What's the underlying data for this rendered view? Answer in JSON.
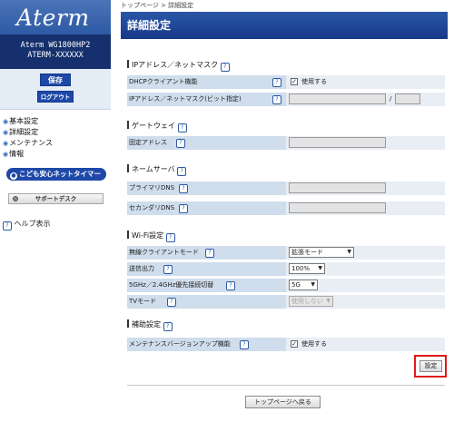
{
  "sidebar": {
    "logo": "Aterm",
    "model_line1": "Aterm WG1800HP2",
    "model_line2": "ATERM-XXXXXX",
    "save_label": "保存",
    "logout_label": "ログアウト",
    "menu": [
      "基本設定",
      "詳細設定",
      "メンテナンス",
      "情報"
    ],
    "kodomo_label": "こども安心ネットタイマー",
    "support_label": "サポートデスク",
    "help_label": "ヘルプ表示"
  },
  "header": {
    "breadcrumb": "トップページ > 詳細設定",
    "title": "詳細設定"
  },
  "sections": {
    "ip": {
      "title": "IPアドレス／ネットマスク",
      "dhcp_label": "DHCPクライアント機能",
      "dhcp_value": "使用する",
      "ip_label": "IPアドレス／ネットマスク(ビット指定)",
      "ip_value": "",
      "mask_value": "",
      "slash": "/"
    },
    "gateway": {
      "title": "ゲートウェイ",
      "fixed_label": "固定アドレス",
      "fixed_value": ""
    },
    "dns": {
      "title": "ネームサーバ",
      "primary_label": "プライマリDNS",
      "primary_value": "",
      "secondary_label": "セカンダリDNS",
      "secondary_value": ""
    },
    "wifi": {
      "title": "Wi-Fi設定",
      "mode_label": "無線クライアントモード",
      "mode_value": "拡張モード",
      "power_label": "送信出力",
      "power_value": "100%",
      "band_label": "5GHz／2.4GHz優先接続切替",
      "band_value": "5G",
      "tv_label": "TVモード",
      "tv_value": "使用しない"
    },
    "aux": {
      "title": "補助設定",
      "maint_label": "メンテナンスバージョンアップ機能",
      "maint_value": "使用する"
    }
  },
  "actions": {
    "settei_label": "設定",
    "back_label": "トップページへ戻る"
  },
  "icons": {
    "help": "?",
    "check": "✓",
    "dropdown": "▼"
  },
  "colors": {
    "brand_blue": "#1f49a8",
    "highlight_red": "#e01818",
    "label_bg": "#cfddec"
  }
}
